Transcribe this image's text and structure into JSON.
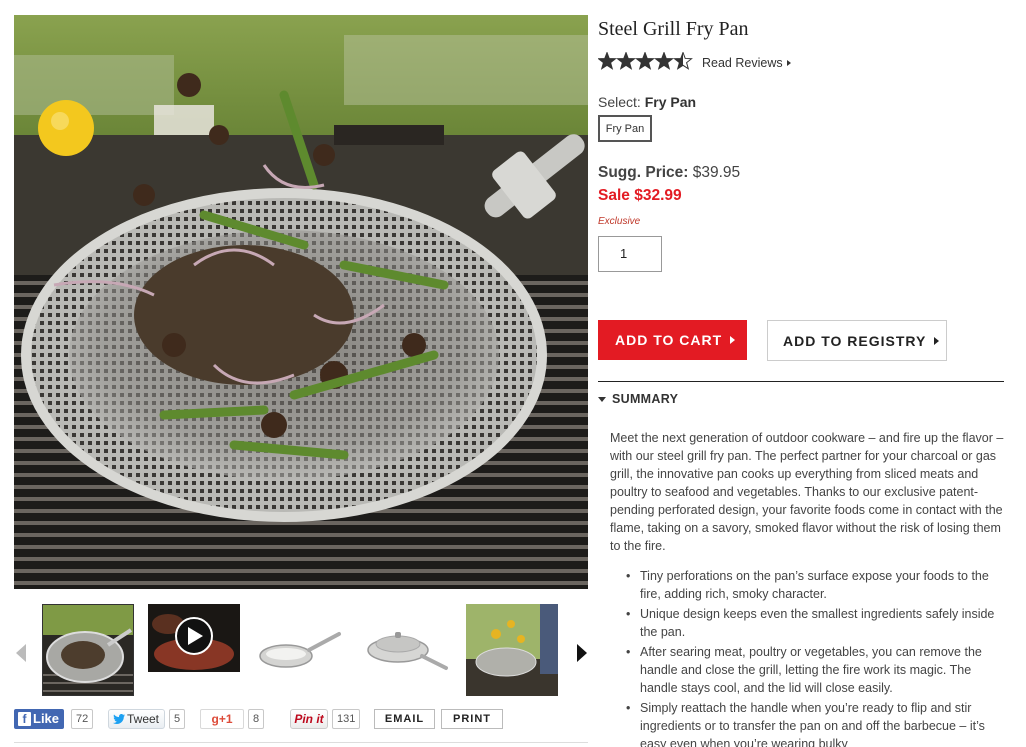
{
  "product": {
    "title": "Steel Grill Fry Pan",
    "rating": 4.5,
    "rating_max": 5,
    "read_reviews_label": "Read Reviews",
    "select_prefix": "Select:",
    "select_value": "Fry Pan",
    "option_label": "Fry Pan",
    "sugg_price_label": "Sugg. Price:",
    "sugg_price_value": "$39.95",
    "sale_label": "Sale",
    "sale_value": "$32.99",
    "exclusive_label": "Exclusive",
    "quantity": "1"
  },
  "actions": {
    "add_to_cart": "ADD TO CART",
    "add_to_registry": "ADD TO REGISTRY"
  },
  "summary": {
    "heading": "SUMMARY",
    "description": "Meet the next generation of outdoor cookware – and fire up the flavor – with our steel grill fry pan. The perfect partner for your charcoal or gas grill, the innovative pan cooks up everything from sliced meats and poultry to seafood and vegetables. Thanks to our exclusive patent-pending perforated design, your favorite foods come in contact with the flame, taking on a savory, smoked flavor without the risk of losing them to the fire.",
    "bullets": [
      "Tiny perforations on the pan’s surface expose your foods to the fire, adding rich, smoky character.",
      "Unique design keeps even the smallest ingredients safely inside the pan.",
      "After searing meat, poultry or vegetables, you can remove the handle and close the grill, letting the fire work its magic. The handle stays cool, and the lid will close easily.",
      "Simply reattach the handle when you’re ready to flip and stir ingredients or to transfer the pan on and off the barbecue – it’s easy even when you’re wearing bulky"
    ]
  },
  "gallery": {
    "thumbnails": [
      "grill-pan-vegetables",
      "video-play",
      "fry-pan-side",
      "fry-pan-with-lid",
      "grill-outdoor-scene"
    ]
  },
  "social": {
    "facebook_label": "Like",
    "facebook_count": "72",
    "twitter_label": "Tweet",
    "twitter_count": "5",
    "gplus_label": "g+1",
    "gplus_count": "8",
    "pinterest_label": "Pin it",
    "pinterest_count": "131",
    "email_label": "EMAIL",
    "print_label": "PRINT"
  },
  "colors": {
    "accent_red": "#e31b23",
    "facebook_blue": "#4267b2"
  }
}
